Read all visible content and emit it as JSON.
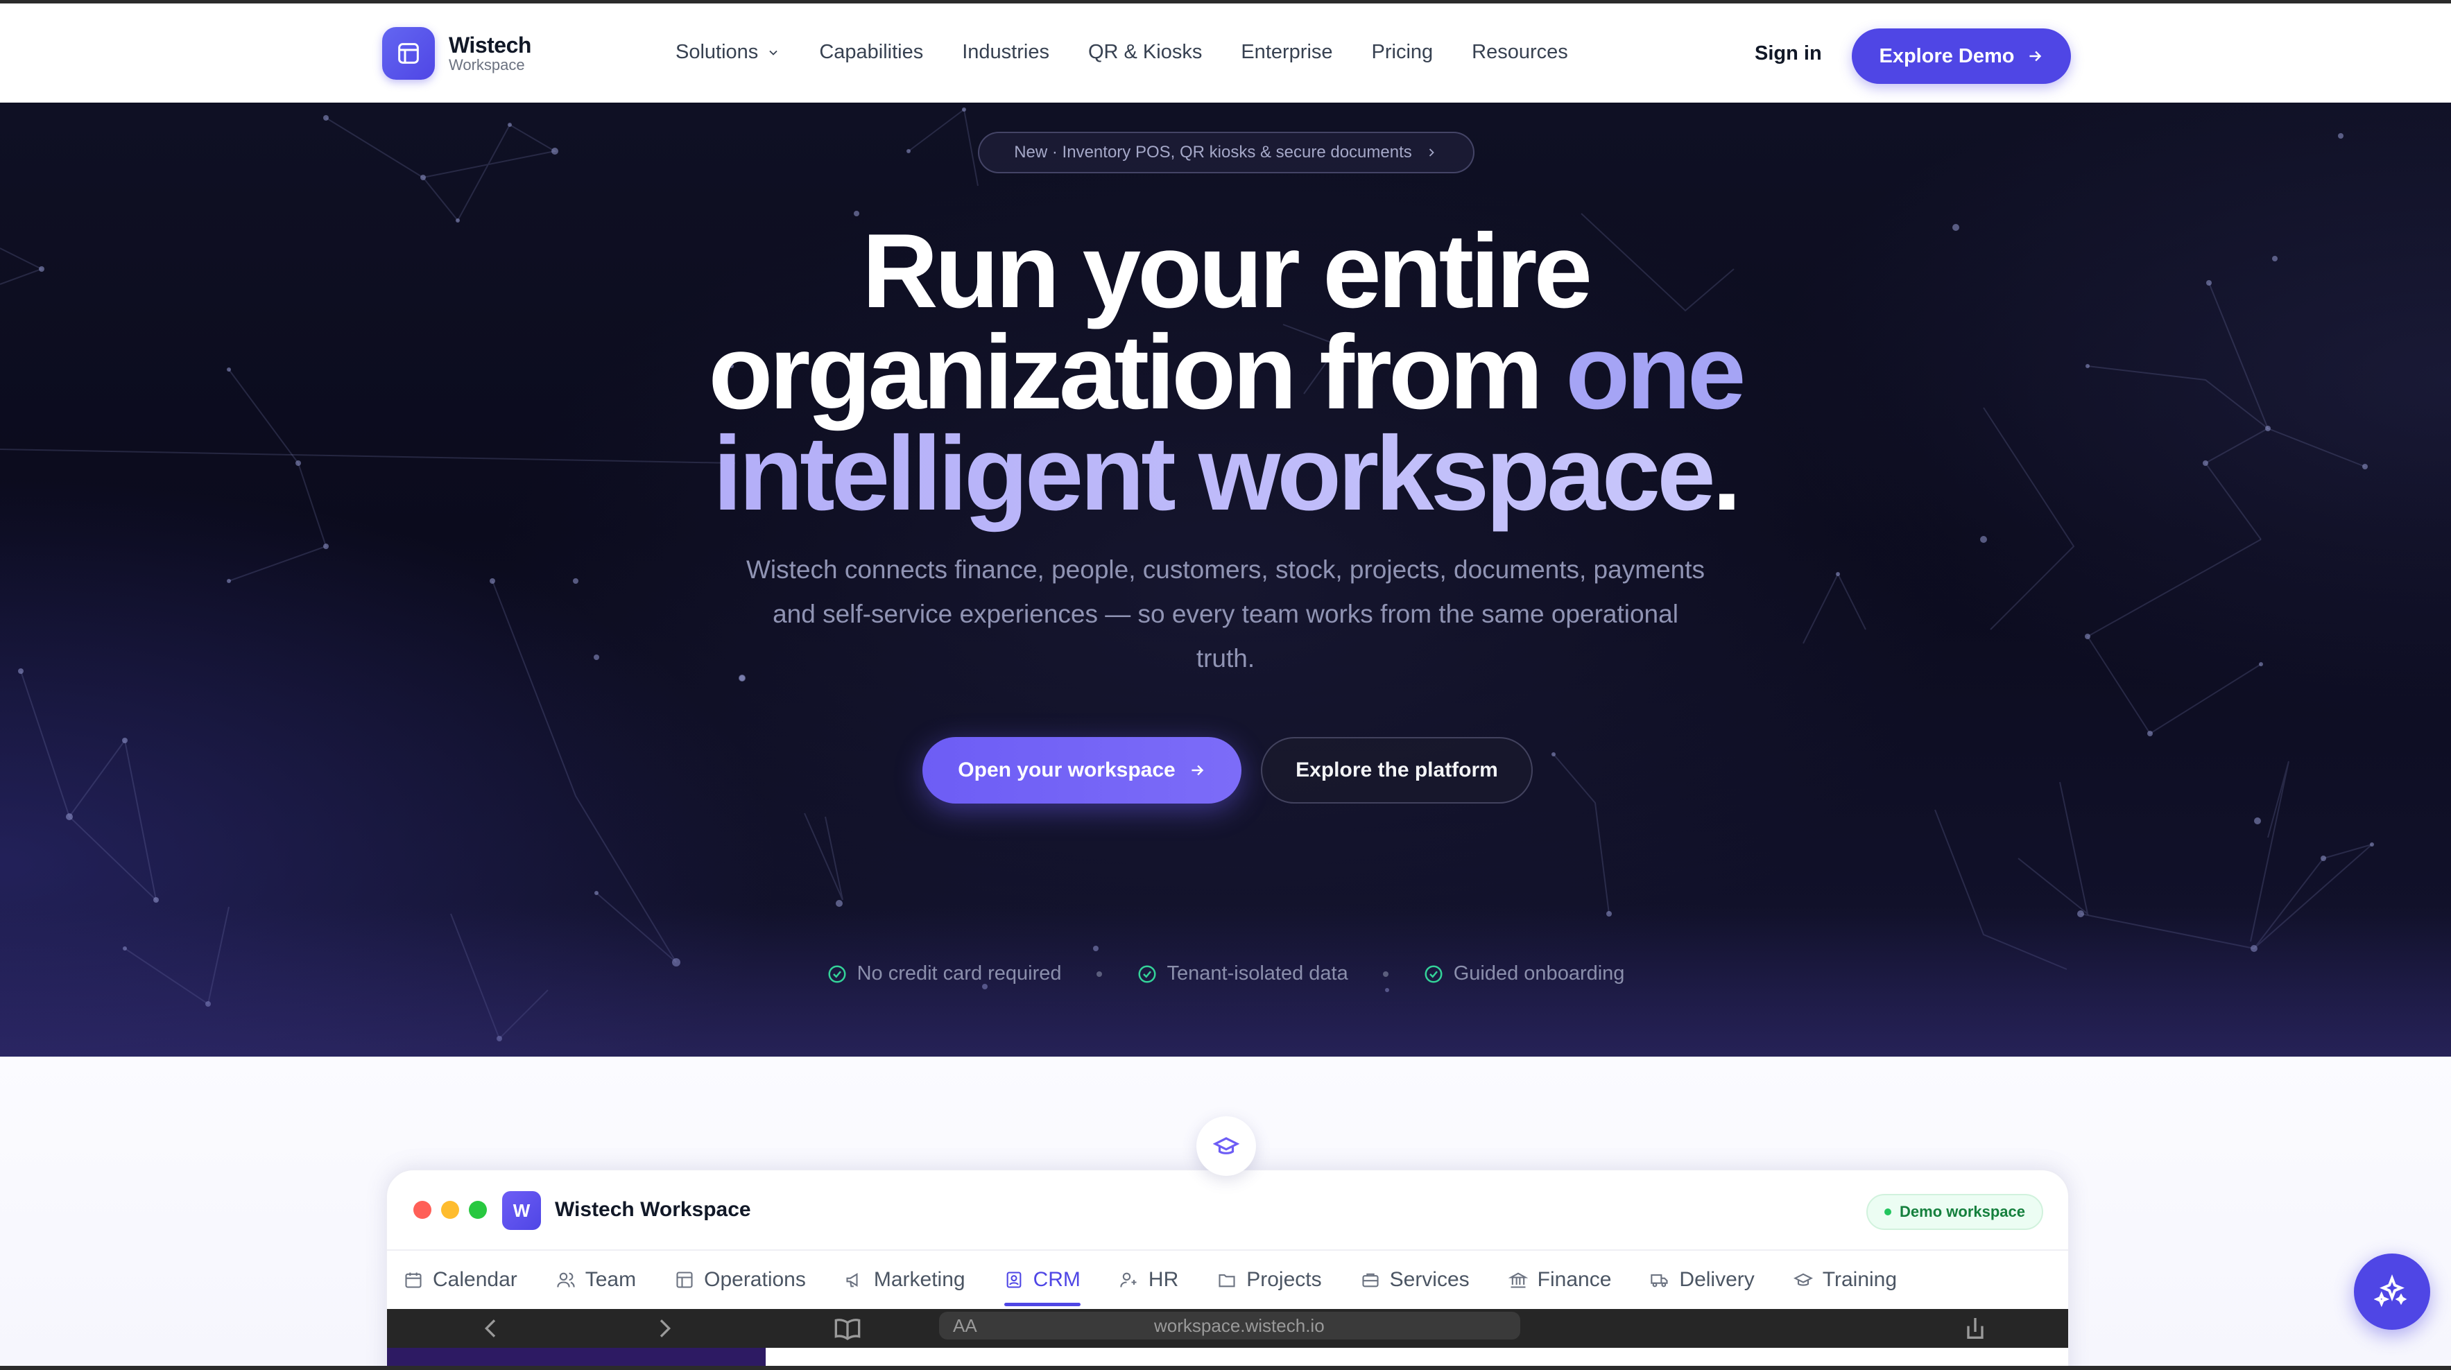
{
  "brand": {
    "name": "Wistech",
    "sub": "Workspace"
  },
  "nav": {
    "links": [
      "Solutions",
      "Capabilities",
      "Industries",
      "QR & Kiosks",
      "Enterprise",
      "Pricing",
      "Resources"
    ],
    "sign_in": "Sign in",
    "demo": "Explore Demo"
  },
  "hero": {
    "pill": "New · Inventory POS, QR kiosks & secure documents",
    "headline_line1": "Run your entire",
    "headline_line2a": "organization from ",
    "headline_line2b": "one",
    "headline_line3": "intelligent workspace",
    "headline_dot": ".",
    "sub": "Wistech connects finance, people, customers, stock, projects, documents, payments and self-service experiences — so every team works from the same operational truth.",
    "cta_primary": "Open your workspace",
    "cta_secondary": "Explore the platform",
    "checks": [
      "No credit card required",
      "Tenant-isolated data",
      "Guided onboarding"
    ]
  },
  "window": {
    "logo_letter": "W",
    "title": "Wistech Workspace",
    "badge": "Demo workspace",
    "tabs": [
      "Calendar",
      "Team",
      "Operations",
      "Marketing",
      "CRM",
      "HR",
      "Projects",
      "Services",
      "Finance",
      "Delivery",
      "Training"
    ],
    "active_tab": "CRM",
    "url_aa": "AA",
    "url": "workspace.wistech.io"
  },
  "colors": {
    "accent": "#4f46e5",
    "hero_bg": "#0b0b1d",
    "headline_accent": "#a5a4f5",
    "check": "#34d399"
  }
}
